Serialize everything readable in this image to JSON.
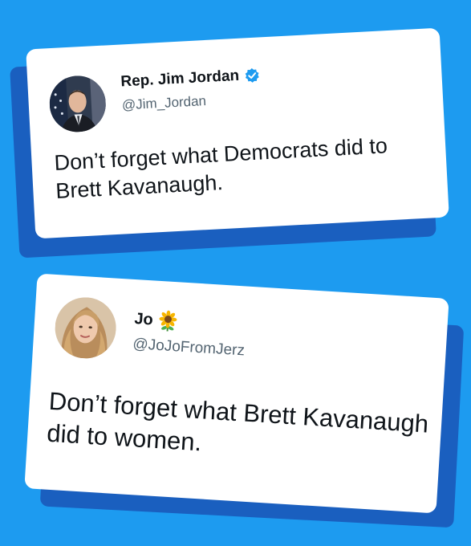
{
  "tweets": [
    {
      "display_name": "Rep. Jim Jordan",
      "handle": "@Jim_Jordan",
      "text": "Don’t forget what Democrats did to Brett Kavanaugh.",
      "badge_icon": "verified-icon",
      "avatar_icon": "profile-photo-man-suit-flag"
    },
    {
      "display_name": "Jo",
      "handle": "@JoJoFromJerz",
      "text": "Don’t forget what Brett Kavanaugh did to women.",
      "badge_icon": "sunflower-icon",
      "avatar_icon": "profile-photo-woman-blonde"
    }
  ],
  "colors": {
    "background": "#1d9bf0",
    "card_shadow": "#1a5fbf",
    "card": "#ffffff",
    "verified_badge": "#1d9bf0",
    "name_text": "#0f1419",
    "handle_text": "#536471"
  }
}
